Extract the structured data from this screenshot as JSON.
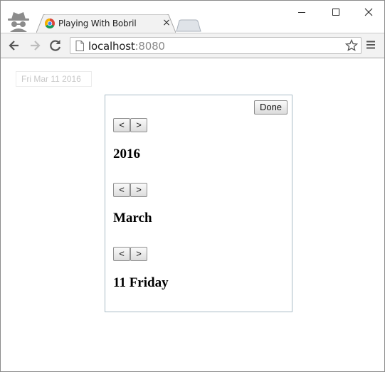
{
  "browser": {
    "tab_title": "Playing With Bobril",
    "tab_close": "×",
    "url_host": "localhost",
    "url_port": ":8080"
  },
  "page": {
    "date_input_value": "Fri Mar 11 2016",
    "picker": {
      "done_label": "Done",
      "prev_label": "<",
      "next_label": ">",
      "year": "2016",
      "month": "March",
      "day": "11 Friday"
    }
  }
}
